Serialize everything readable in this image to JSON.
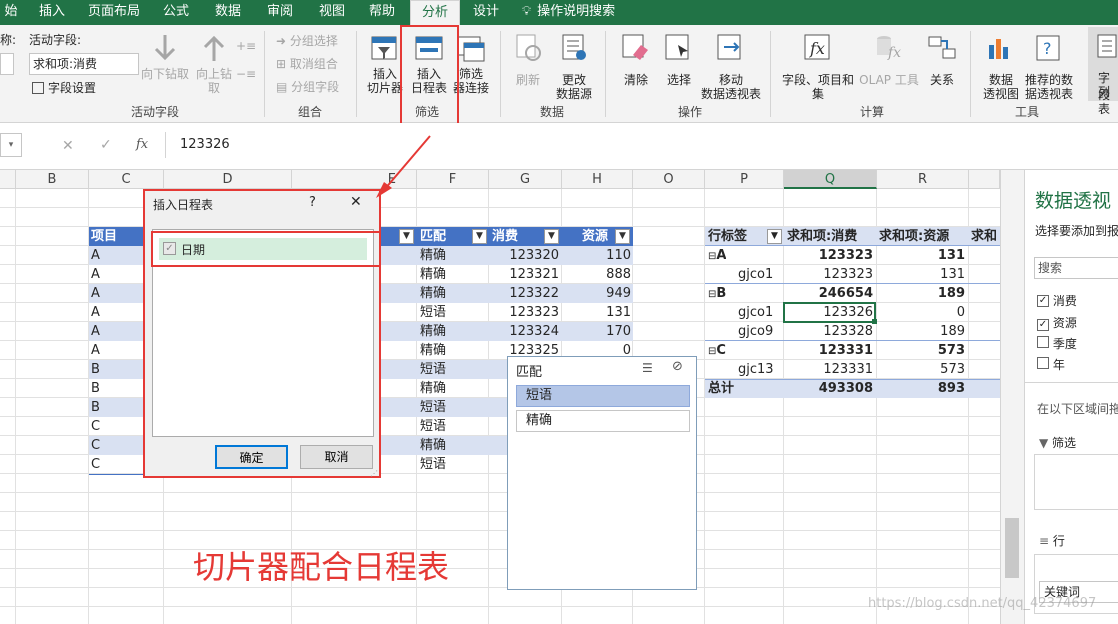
{
  "tabs": [
    "始",
    "插入",
    "页面布局",
    "公式",
    "数据",
    "审阅",
    "视图",
    "帮助",
    "分析",
    "设计",
    "操作说明搜索"
  ],
  "active_tab": "分析",
  "ribbon": {
    "active_field": {
      "name_label_partial": "称:",
      "label": "活动字段:",
      "value": "求和项:消费",
      "settings": "字段设置",
      "drill_down": "向下钻取",
      "drill_up": "向上钻",
      "drill_up2": "取",
      "group": "活动字段"
    },
    "grouping": {
      "sel": "分组选择",
      "ungroup": "取消组合",
      "field": "分组字段",
      "group": "组合"
    },
    "filter": {
      "slicer1": "插入",
      "slicer2": "切片器",
      "timeline1": "插入",
      "timeline2": "日程表",
      "conn1": "筛选",
      "conn2": "器连接",
      "group": "筛选"
    },
    "data": {
      "refresh": "刷新",
      "change1": "更改",
      "change2": "数据源",
      "group": "数据"
    },
    "actions": {
      "clear": "清除",
      "select": "选择",
      "move1": "移动",
      "move2": "数据透视表",
      "group": "操作"
    },
    "calc": {
      "fields1": "字段、项目和",
      "fields2": "集",
      "olap": "OLAP 工具",
      "rel": "关系",
      "group": "计算"
    },
    "tools": {
      "chart1": "数据",
      "chart2": "透视图",
      "rec1": "推荐的数",
      "rec2": "据透视表",
      "group": "工具"
    },
    "show": {
      "list1": "字段",
      "list2": "列表"
    }
  },
  "formula_bar": {
    "value": "123326",
    "fx": "fx"
  },
  "columns": [
    "B",
    "C",
    "D",
    "E",
    "F",
    "G",
    "H",
    "O",
    "P",
    "Q",
    "R"
  ],
  "table": {
    "headers": [
      "项目",
      "匹配",
      "消费",
      "资源"
    ],
    "rows": [
      [
        "A",
        "精确",
        "123320",
        "110"
      ],
      [
        "A",
        "精确",
        "123321",
        "888"
      ],
      [
        "A",
        "精确",
        "123322",
        "949"
      ],
      [
        "A",
        "短语",
        "123323",
        "131"
      ],
      [
        "A",
        "精确",
        "123324",
        "170"
      ],
      [
        "A",
        "精确",
        "123325",
        "0"
      ],
      [
        "B",
        "短语",
        "",
        ""
      ],
      [
        "B",
        "精确",
        "",
        ""
      ],
      [
        "B",
        "短语",
        "",
        ""
      ],
      [
        "C",
        "短语",
        "",
        ""
      ],
      [
        "C",
        "精确",
        "",
        ""
      ],
      [
        "C",
        "短语",
        "",
        ""
      ]
    ]
  },
  "pivot": {
    "headers": [
      "行标签",
      "求和项:消费",
      "求和项:资源",
      "求和"
    ],
    "rows": [
      {
        "label": "A",
        "v1": "123323",
        "v2": "131",
        "bold": true,
        "expand": "⊟"
      },
      {
        "label": "gjco1",
        "v1": "123323",
        "v2": "131",
        "bold": false
      },
      {
        "label": "B",
        "v1": "246654",
        "v2": "189",
        "bold": true,
        "expand": "⊟"
      },
      {
        "label": "gjco1",
        "v1": "123326",
        "v2": "0",
        "bold": false
      },
      {
        "label": "gjco9",
        "v1": "123328",
        "v2": "189",
        "bold": false
      },
      {
        "label": "C",
        "v1": "123331",
        "v2": "573",
        "bold": true,
        "expand": "⊟"
      },
      {
        "label": "gjc13",
        "v1": "123331",
        "v2": "573",
        "bold": false
      },
      {
        "label": "总计",
        "v1": "493308",
        "v2": "893",
        "bold": true
      }
    ]
  },
  "dialog": {
    "title": "插入日程表",
    "help": "?",
    "close": "✕",
    "item": "日期",
    "ok": "确定",
    "cancel": "取消"
  },
  "slicer": {
    "title": "匹配",
    "items": [
      "短语",
      "精确"
    ]
  },
  "pane": {
    "title": "数据透视",
    "subtitle": "选择要添加到报",
    "search": "搜索",
    "fields": [
      "消费",
      "资源",
      "季度",
      "年"
    ],
    "checked": [
      true,
      true,
      false,
      false
    ],
    "drag_hint": "在以下区域间拖",
    "filter": "筛选",
    "rows": "行",
    "rows_item": "关键词"
  },
  "caption": "切片器配合日程表",
  "watermark": "https://blog.csdn.net/qq_42374697",
  "colors": {
    "excel_green": "#217346",
    "highlight_red": "#e53935",
    "table_blue": "#4472c4",
    "band": "#d9e1f2"
  }
}
